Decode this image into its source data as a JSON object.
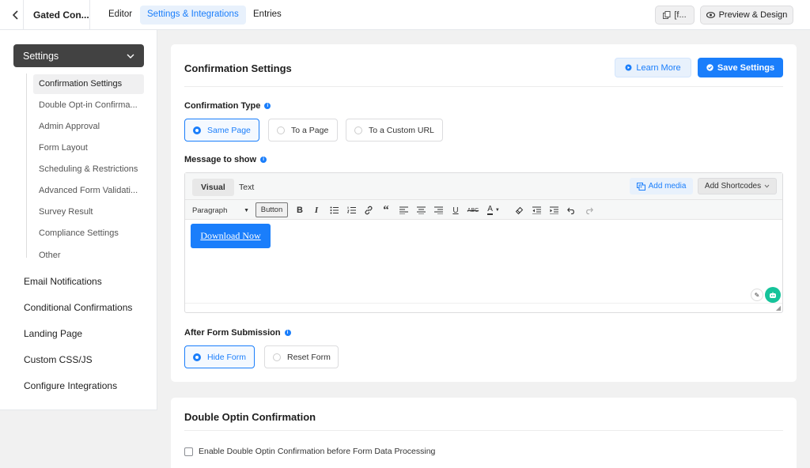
{
  "topbar": {
    "back_icon": "chevron-left-icon",
    "form_title": "Gated Con...",
    "tabs": [
      {
        "label": "Editor"
      },
      {
        "label": "Settings & Integrations"
      },
      {
        "label": "Entries"
      }
    ],
    "active_tab": "Settings & Integrations",
    "shortcode_label": "[f...",
    "preview_label": "Preview & Design"
  },
  "sidebar": {
    "settings_label": "Settings",
    "sub_items": [
      {
        "label": "Confirmation Settings"
      },
      {
        "label": "Double Opt-in Confirma..."
      },
      {
        "label": "Admin Approval"
      },
      {
        "label": "Form Layout"
      },
      {
        "label": "Scheduling & Restrictions"
      },
      {
        "label": "Advanced Form Validati..."
      },
      {
        "label": "Survey Result"
      },
      {
        "label": "Compliance Settings"
      },
      {
        "label": "Other"
      }
    ],
    "items": [
      {
        "label": "Email Notifications"
      },
      {
        "label": "Conditional Confirmations"
      },
      {
        "label": "Landing Page"
      },
      {
        "label": "Custom CSS/JS"
      },
      {
        "label": "Configure Integrations"
      }
    ]
  },
  "confirmation": {
    "title": "Confirmation Settings",
    "learn_more": "Learn More",
    "save": "Save Settings",
    "type_label": "Confirmation Type",
    "type_options": [
      {
        "label": "Same Page",
        "selected": true
      },
      {
        "label": "To a Page",
        "selected": false
      },
      {
        "label": "To a Custom URL",
        "selected": false
      }
    ],
    "message_label": "Message to show",
    "editor": {
      "tab_visual": "Visual",
      "tab_text": "Text",
      "add_media": "Add media",
      "add_shortcodes": "Add Shortcodes",
      "paragraph": "Paragraph",
      "button": "Button",
      "content_button": "Download Now"
    },
    "after_label": "After Form Submission",
    "after_options": [
      {
        "label": "Hide Form",
        "selected": true
      },
      {
        "label": "Reset Form",
        "selected": false
      }
    ]
  },
  "double_optin": {
    "title": "Double Optin Confirmation",
    "checkbox_label": "Enable Double Optin Confirmation before Form Data Processing"
  },
  "colors": {
    "accent": "#1a7efb",
    "sidebar_active": "#424242"
  }
}
